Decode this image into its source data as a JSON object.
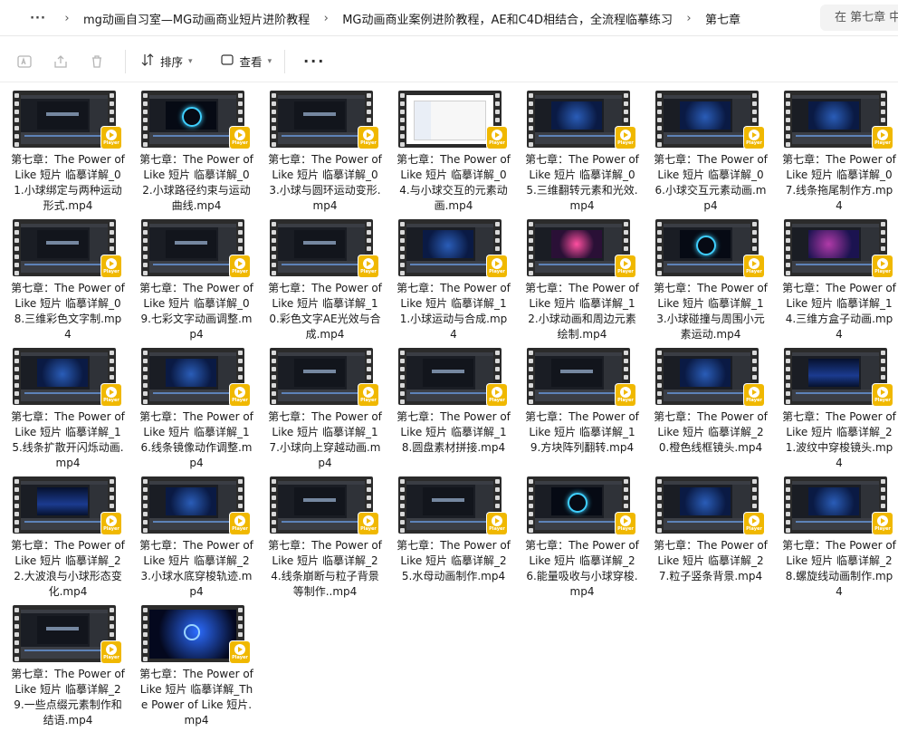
{
  "breadcrumb": {
    "overflow": "···",
    "segments": [
      "mg动画自习室—MG动画商业短片进阶教程",
      "MG动画商业案例进阶教程，AE和C4D相结合，全流程临摹练习",
      "第七章"
    ]
  },
  "search": {
    "placeholder": "在 第七章 中搜索"
  },
  "toolbar": {
    "sort_label": "排序",
    "view_label": "查看",
    "more_label": "···"
  },
  "badge_label": "Player",
  "files": [
    {
      "name": "第七章：The Power of Like 短片 临摹详解_01.小球绑定与两种运动形式.mp4",
      "style": "s-dark"
    },
    {
      "name": "第七章：The Power of Like 短片 临摹详解_02.小球路径约束与运动曲线.mp4",
      "style": "s-ring"
    },
    {
      "name": "第七章：The Power of Like 短片 临摹详解_03.小球与圆环运动变形.mp4",
      "style": "s-dark"
    },
    {
      "name": "第七章：The Power of Like 短片 临摹详解_04.与小球交互的元素动画.mp4",
      "style": "s-win"
    },
    {
      "name": "第七章：The Power of Like 短片 临摹详解_05.三维翻转元素和光效.mp4",
      "style": "s-blue"
    },
    {
      "name": "第七章：The Power of Like 短片 临摹详解_06.小球交互元素动画.mp4",
      "style": "s-blue"
    },
    {
      "name": "第七章：The Power of Like 短片 临摹详解_07.线条拖尾制作方.mp4",
      "style": "s-blue"
    },
    {
      "name": "第七章：The Power of Like 短片 临摹详解_08.三维彩色文字制.mp4",
      "style": "s-dark"
    },
    {
      "name": "第七章：The Power of Like 短片 临摹详解_09.七彩文字动画调整.mp4",
      "style": "s-dark"
    },
    {
      "name": "第七章：The Power of Like 短片 临摹详解_10.彩色文字AE光效与合成.mp4",
      "style": "s-dark"
    },
    {
      "name": "第七章：The Power of Like 短片 临摹详解_11.小球运动与合成.mp4",
      "style": "s-blue"
    },
    {
      "name": "第七章：The Power of Like 短片 临摹详解_12.小球动画和周边元素绘制.mp4",
      "style": "s-pink"
    },
    {
      "name": "第七章：The Power of Like 短片 临摹详解_13.小球碰撞与周围小元素运动.mp4",
      "style": "s-ring"
    },
    {
      "name": "第七章：The Power of Like 短片 临摹详解_14.三维方盒子动画.mp4",
      "style": "s-purple"
    },
    {
      "name": "第七章：The Power of Like 短片 临摹详解_15.线条扩散开闪烁动画.mp4",
      "style": "s-blue"
    },
    {
      "name": "第七章：The Power of Like 短片 临摹详解_16.线条镜像动作调整.mp4",
      "style": "s-blue"
    },
    {
      "name": "第七章：The Power of Like 短片 临摹详解_17.小球向上穿越动画.mp4",
      "style": "s-dark"
    },
    {
      "name": "第七章：The Power of Like 短片 临摹详解_18.圆盘素材拼接.mp4",
      "style": "s-dark"
    },
    {
      "name": "第七章：The Power of Like 短片 临摹详解_19.方块阵列翻转.mp4",
      "style": "s-dark"
    },
    {
      "name": "第七章：The Power of Like 短片 临摹详解_20.橙色线框镜头.mp4",
      "style": "s-blue"
    },
    {
      "name": "第七章：The Power of Like 短片 临摹详解_21.波纹中穿梭镜头.mp4",
      "style": "s-wave"
    },
    {
      "name": "第七章：The Power of Like 短片 临摹详解_22.大波浪与小球形态变化.mp4",
      "style": "s-wave"
    },
    {
      "name": "第七章：The Power of Like 短片 临摹详解_23.小球水底穿梭轨迹.mp4",
      "style": "s-blue"
    },
    {
      "name": "第七章：The Power of Like 短片 临摹详解_24.线条崩断与粒子背景等制作..mp4",
      "style": "s-dark"
    },
    {
      "name": "第七章：The Power of Like 短片 临摹详解_25.水母动画制作.mp4",
      "style": "s-dark"
    },
    {
      "name": "第七章：The Power of Like 短片 临摹详解_26.能量吸收与小球穿梭.mp4",
      "style": "s-ring"
    },
    {
      "name": "第七章：The Power of Like 短片 临摹详解_27.粒子竖条背景.mp4",
      "style": "s-blue"
    },
    {
      "name": "第七章：The Power of Like 短片 临摹详解_28.螺旋线动画制作.mp4",
      "style": "s-blue"
    },
    {
      "name": "第七章：The Power of Like 短片 临摹详解_29.一些点缀元素制作和结语.mp4",
      "style": "s-dark"
    },
    {
      "name": "第七章：The Power of Like 短片 临摹详解_The Power of Like 短片.mp4",
      "style": "s-space"
    }
  ]
}
